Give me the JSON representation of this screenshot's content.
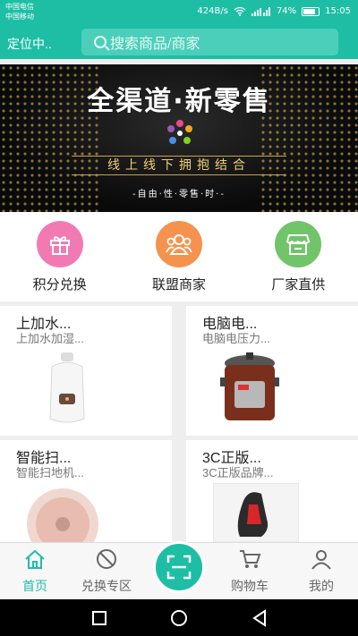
{
  "status_bar": {
    "carrier1": "中国电信",
    "carrier2": "中国移动",
    "network_speed": "424B/s",
    "battery": "74%",
    "time": "15:05"
  },
  "header": {
    "location": "定位中..",
    "search_placeholder": "搜索商品/商家"
  },
  "banner": {
    "title": "全渠道·新零售",
    "subtitle": "线上线下拥抱结合",
    "footer": "-自由·性·零售·时·-"
  },
  "categories": [
    {
      "label": "积分兑换",
      "color": "#f27ab3",
      "icon": "gift-icon"
    },
    {
      "label": "联盟商家",
      "color": "#f5924e",
      "icon": "group-icon"
    },
    {
      "label": "厂家直供",
      "color": "#72c46a",
      "icon": "store-icon"
    }
  ],
  "products": [
    {
      "title": "上加水...",
      "subtitle": "上加水加湿...",
      "image": "humidifier-image"
    },
    {
      "title": "电脑电...",
      "subtitle": "电脑电压力...",
      "image": "pressure-cooker-image"
    },
    {
      "title": "智能扫...",
      "subtitle": "智能扫地机...",
      "image": "robot-vacuum-image"
    },
    {
      "title": "3C正版...",
      "subtitle": "3C正版品牌...",
      "image": "car-seat-image"
    }
  ],
  "tabs": [
    {
      "label": "首页",
      "icon": "home-icon",
      "active": true
    },
    {
      "label": "兑换专区",
      "icon": "no-entry-icon",
      "active": false
    },
    {
      "label": "",
      "icon": "scan-icon",
      "active": false
    },
    {
      "label": "购物车",
      "icon": "cart-icon",
      "active": false
    },
    {
      "label": "我的",
      "icon": "user-icon",
      "active": false
    }
  ],
  "accent_color": "#1ebea5"
}
